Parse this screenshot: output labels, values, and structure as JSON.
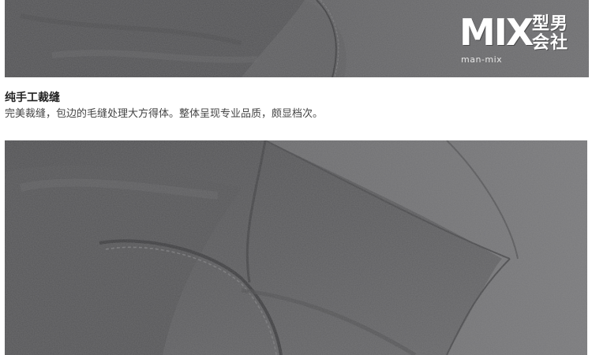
{
  "brand": {
    "mark": "MIX",
    "name_line1": "型男",
    "name_line2": "会社",
    "sub": "man-mix"
  },
  "section": {
    "title": "纯手工裁缝",
    "description": "完美裁缝，包边的毛缝处理大方得体。整体呈现专业品质，颇显档次。"
  },
  "colors": {
    "fabric_dark": "#4a4a4c",
    "fabric_mid": "#5e5e60",
    "fabric_light": "#747476",
    "text_title": "#222222",
    "text_body": "#444444"
  }
}
